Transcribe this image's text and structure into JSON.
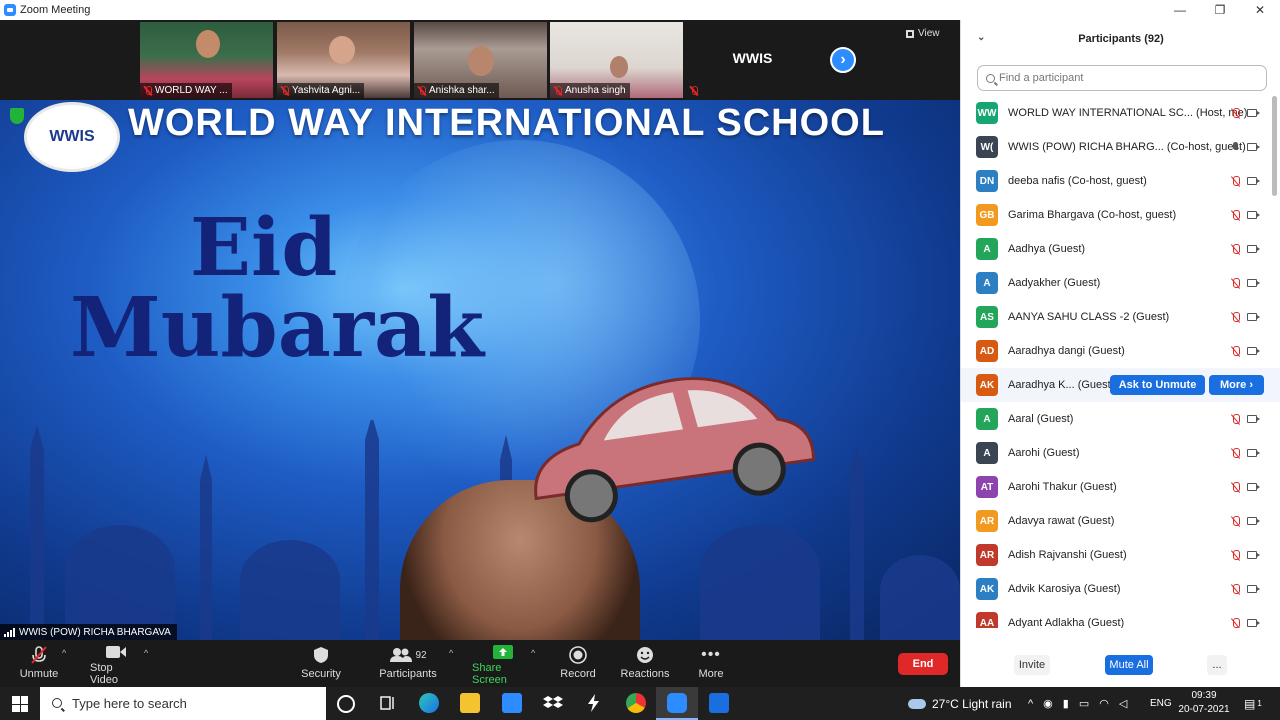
{
  "window": {
    "title": "Zoom Meeting",
    "controls": [
      "—",
      "❐",
      "✕"
    ]
  },
  "gallery_strip": {
    "thumbnails": [
      {
        "name": "WORLD WAY ..."
      },
      {
        "name": "Yashvita Agni..."
      },
      {
        "name": "Anishka shar..."
      },
      {
        "name": "Anusha singh"
      }
    ],
    "wwis_label": "WWIS",
    "next_label": "›",
    "view_label": "View"
  },
  "main_video": {
    "banner": "WORLD WAY INTERNATIONAL SCHOOL",
    "logo_text": "WWIS",
    "greeting_line1": "Eid",
    "greeting_line2": "Mubarak",
    "speaker_name": "WWIS (POW) RICHA BHARGAVA"
  },
  "toolbar": {
    "unmute": "Unmute",
    "stop_video": "Stop Video",
    "security": "Security",
    "participants": "Participants",
    "participants_count": "92",
    "share_screen": "Share Screen",
    "record": "Record",
    "reactions": "Reactions",
    "more": "More",
    "end": "End",
    "share_color": "#23b23a",
    "end_color": "#e02828"
  },
  "panel": {
    "title": "Participants (92)",
    "search_placeholder": "Find a participant",
    "participants": [
      {
        "initials": "WW",
        "name": "WORLD WAY INTERNATIONAL SC... (Host, me)",
        "color": "#17a673",
        "mic": "off"
      },
      {
        "initials": "W(",
        "name": "WWIS (POW) RICHA BHARG... (Co-host, guest)",
        "color": "#3a4453",
        "mic": "on"
      },
      {
        "initials": "DN",
        "name": "deeba nafis (Co-host, guest)",
        "color": "#2b7fc2",
        "mic": "off"
      },
      {
        "initials": "GB",
        "name": "Garima Bhargava (Co-host, guest)",
        "color": "#f29a1f",
        "mic": "off"
      },
      {
        "initials": "A",
        "name": "Aadhya (Guest)",
        "color": "#23a65a",
        "mic": "off"
      },
      {
        "initials": "A",
        "name": "Aadyakher (Guest)",
        "color": "#2b7fc2",
        "mic": "off"
      },
      {
        "initials": "AS",
        "name": "AANYA SAHU CLASS -2 (Guest)",
        "color": "#23a65a",
        "mic": "off"
      },
      {
        "initials": "AD",
        "name": "Aaradhya dangi (Guest)",
        "color": "#d85a12",
        "mic": "off"
      },
      {
        "initials": "AK",
        "name": "Aaradhya K... (Guest)",
        "color": "#d85a12",
        "mic": "off",
        "hover": true
      },
      {
        "initials": "A",
        "name": "Aaral (Guest)",
        "color": "#23a65a",
        "mic": "off"
      },
      {
        "initials": "A",
        "name": "Aarohi (Guest)",
        "color": "#3a4453",
        "mic": "off"
      },
      {
        "initials": "AT",
        "name": "Aarohi Thakur (Guest)",
        "color": "#8e44ad",
        "mic": "off"
      },
      {
        "initials": "AR",
        "name": "Adavya rawat (Guest)",
        "color": "#f29a1f",
        "mic": "off"
      },
      {
        "initials": "AR",
        "name": "Adish Rajvanshi (Guest)",
        "color": "#c0392b",
        "mic": "off"
      },
      {
        "initials": "AK",
        "name": "Advik  Karosiya (Guest)",
        "color": "#2b7fc2",
        "mic": "off"
      },
      {
        "initials": "AA",
        "name": "Adyant Adlakha (Guest)",
        "color": "#c0392b",
        "mic": "off"
      }
    ],
    "ask_to_unmute": "Ask to Unmute",
    "more_label": "More ›",
    "invite": "Invite",
    "mute_all": "Mute All",
    "ellipsis": "..."
  },
  "taskbar": {
    "search_placeholder": "Type here to search",
    "weather": "27°C  Light rain",
    "language": "ENG",
    "time": "09:39",
    "date": "20-07-2021",
    "notification_count": "1"
  }
}
